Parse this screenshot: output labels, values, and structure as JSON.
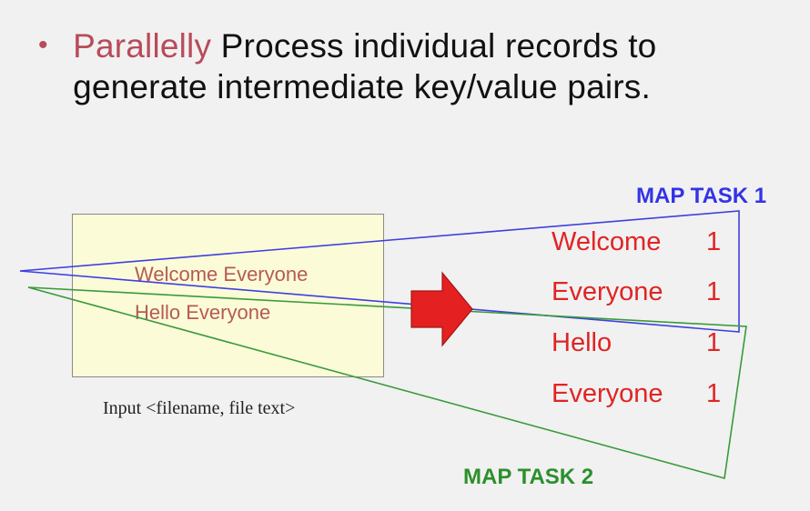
{
  "bullet": {
    "marker": "•",
    "highlight": "Parallelly",
    "text": " Process individual records to generate intermediate key/value pairs."
  },
  "input": {
    "records": [
      "Welcome Everyone",
      "Hello Everyone"
    ],
    "caption": "Input <filename, file text>"
  },
  "tasks": {
    "task1_label": "MAP TASK 1",
    "task2_label": "MAP TASK 2"
  },
  "output": {
    "pairs": [
      {
        "key": "Welcome",
        "value": "1"
      },
      {
        "key": "Everyone",
        "value": "1"
      },
      {
        "key": "Hello",
        "value": "1"
      },
      {
        "key": "Everyone",
        "value": "1"
      }
    ]
  },
  "colors": {
    "accent": "#b84b5a",
    "task1": "#3333e6",
    "task2": "#2c8f2c",
    "pair_text": "#e02424",
    "arrow": "#e52020",
    "input_fill": "#fbfbd8"
  }
}
